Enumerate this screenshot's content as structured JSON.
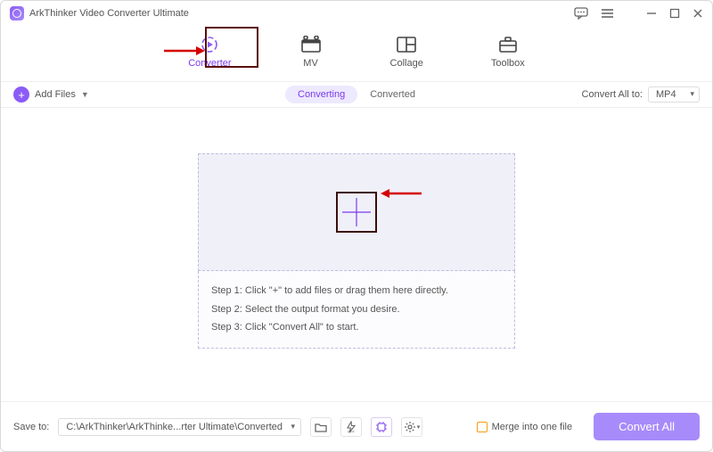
{
  "app": {
    "title": "ArkThinker Video Converter Ultimate"
  },
  "tabs": {
    "converter": "Converter",
    "mv": "MV",
    "collage": "Collage",
    "toolbox": "Toolbox"
  },
  "toolbar": {
    "add_files": "Add Files",
    "converting": "Converting",
    "converted": "Converted",
    "convert_all_to_label": "Convert All to:",
    "format": "MP4"
  },
  "drop": {
    "step1": "Step 1: Click \"+\" to add files or drag them here directly.",
    "step2": "Step 2: Select the output format you desire.",
    "step3": "Step 3: Click \"Convert All\" to start."
  },
  "bottom": {
    "save_to_label": "Save to:",
    "path": "C:\\ArkThinker\\ArkThinke...rter Ultimate\\Converted",
    "merge_label": "Merge into one file",
    "convert_all_btn": "Convert All"
  }
}
